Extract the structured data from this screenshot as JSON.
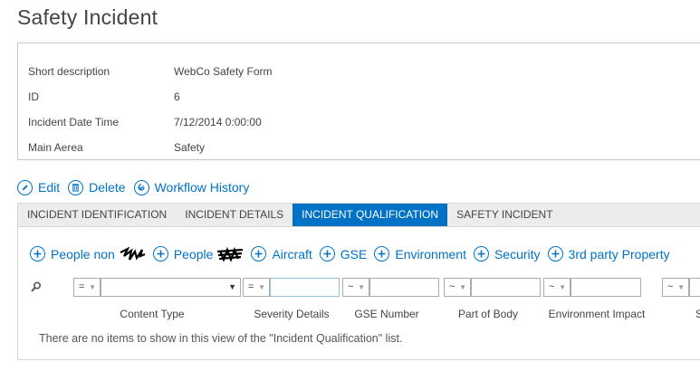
{
  "page": {
    "title": "Safety Incident"
  },
  "properties": [
    {
      "label": "Short description",
      "value": "WebCo Safety Form"
    },
    {
      "label": "ID",
      "value": "6"
    },
    {
      "label": "Incident Date Time",
      "value": "7/12/2014 0:00:00"
    },
    {
      "label": "Main Aerea",
      "value": "Safety"
    }
  ],
  "actions": {
    "edit": "Edit",
    "delete": "Delete",
    "workflow": "Workflow History"
  },
  "tabs": [
    {
      "label": "INCIDENT IDENTIFICATION",
      "active": false
    },
    {
      "label": "INCIDENT DETAILS",
      "active": false
    },
    {
      "label": "INCIDENT QUALIFICATION",
      "active": true
    },
    {
      "label": "SAFETY INCIDENT",
      "active": false
    }
  ],
  "add_links": [
    {
      "label": "People non"
    },
    {
      "label": "People"
    },
    {
      "label": "Aircraft"
    },
    {
      "label": "GSE"
    },
    {
      "label": "Environment"
    },
    {
      "label": "Security"
    },
    {
      "label": "3rd party Property"
    }
  ],
  "filters": {
    "operators": [
      "=",
      "=",
      "~",
      "~",
      "~",
      "~"
    ],
    "columns": [
      "Content Type",
      "Severity Details",
      "GSE Number",
      "Part of Body",
      "Environment Impact",
      "S"
    ]
  },
  "empty_message": "There are no items to show in this view of the \"Incident Qualification\" list.",
  "colors": {
    "accent": "#0072c6",
    "tab_bg": "#ececec"
  }
}
